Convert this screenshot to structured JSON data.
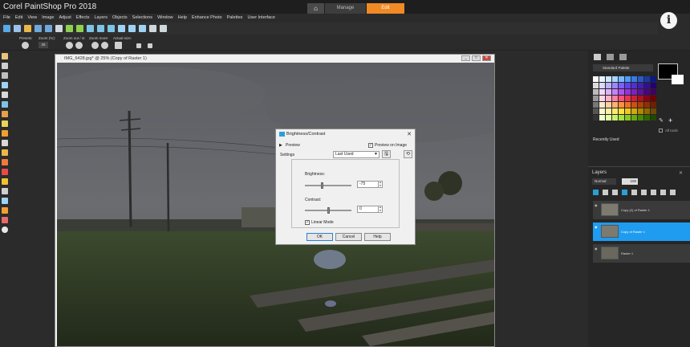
{
  "app": {
    "title": "Corel PaintShop Pro 2018"
  },
  "workspace_tabs": {
    "home_glyph": "⌂",
    "manage": "Manage",
    "edit": "Edit"
  },
  "info_glyph": "i",
  "menu": [
    "File",
    "Edit",
    "View",
    "Image",
    "Adjust",
    "Effects",
    "Layers",
    "Objects",
    "Selections",
    "Window",
    "Help",
    "Enhance Photo",
    "Palettes",
    "User Interface"
  ],
  "options": {
    "presets_label": "Presets:",
    "zoom_label": "Zoom (%):",
    "zoom_value": "25",
    "zoom_out_label": "Zoom out / in:",
    "zoom_more_label": "Zoom more:",
    "actual_label": "Actual size:"
  },
  "document": {
    "title": "IMG_6428.jpg* @ 25% (Copy of Raster 1)"
  },
  "dialog": {
    "title": "Brightness/Contrast",
    "preview_label": "Preview",
    "preview_on_image_label": "Preview on Image",
    "settings_label": "Settings",
    "settings_value": "Last Used",
    "brightness_label": "Brightness:",
    "brightness_value": "-75",
    "contrast_label": "Contrast:",
    "contrast_value": "0",
    "linear_mode_label": "Linear Mode",
    "ok": "OK",
    "cancel": "Cancel",
    "help": "Help"
  },
  "materials": {
    "palette_label": "Standard Palette",
    "all_tools_label": "All tools",
    "recently_used_label": "Recently Used"
  },
  "layers": {
    "title": "Layers",
    "blend_mode": "Normal",
    "opacity": "100",
    "items": [
      {
        "name": "Copy (2) of Raster 1"
      },
      {
        "name": "Copy of Raster 1"
      },
      {
        "name": "Raster 1"
      }
    ]
  },
  "colors": {
    "accent": "#f08a24",
    "selection": "#1f9bf0"
  }
}
